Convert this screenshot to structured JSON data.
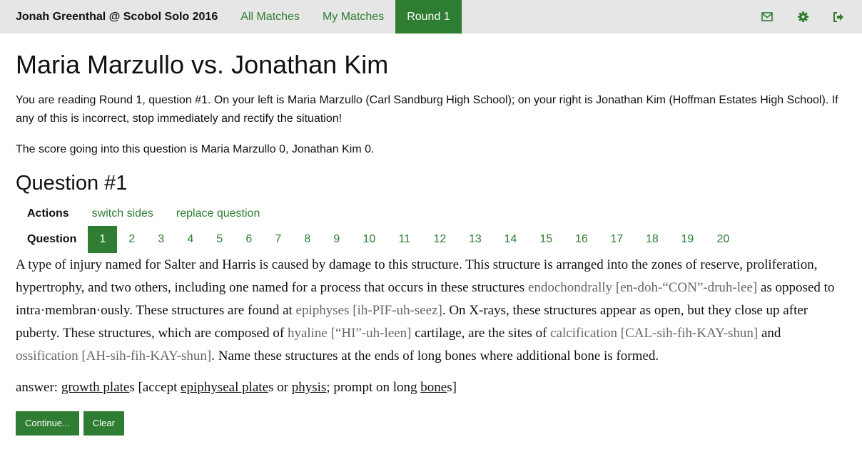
{
  "navbar": {
    "brand": "Jonah Greenthal @ Scobol Solo 2016",
    "links": [
      "All Matches",
      "My Matches",
      "Round 1"
    ],
    "icons": [
      "envelope-icon",
      "gear-icon",
      "sign-out-icon"
    ]
  },
  "colors": {
    "accent": "#2e7d32",
    "nav_bg": "#e6e6e6",
    "pronunciation": "#666666"
  },
  "match": {
    "title": "Maria Marzullo vs. Jonathan Kim",
    "intro": "You are reading Round 1, question #1. On your left is Maria Marzullo (Carl Sandburg High School); on your right is Jonathan Kim (Hoffman Estates High School). If any of this is incorrect, stop immediately and rectify the situation!",
    "score": "The score going into this question is Maria Marzullo 0, Jonathan Kim 0."
  },
  "question": {
    "heading": "Question #1",
    "actions_label": "Actions",
    "actions": [
      "switch sides",
      "replace question"
    ],
    "nav_label": "Question",
    "numbers": [
      "1",
      "2",
      "3",
      "4",
      "5",
      "6",
      "7",
      "8",
      "9",
      "10",
      "11",
      "12",
      "13",
      "14",
      "15",
      "16",
      "17",
      "18",
      "19",
      "20"
    ],
    "text": {
      "t1": "A type of injury named for Salter and Harris is caused by damage to this structure. This structure is arranged into the zones of reserve, proliferation, hypertrophy, and two others, including one named for a process that occurs in these structures ",
      "p1": "endochondrally [en-doh-“CON”-druh-lee]",
      "t2": " as opposed to intra·membran·ously. These structures are found at ",
      "p2": "epiphyses [ih-PIF-uh-seez]",
      "t3": ". On X-rays, these structures appear as open, but they close up after puberty. These structures, which are composed of ",
      "p3": "hyaline [“HI”-uh-leen]",
      "t4": " cartilage, are the sites of ",
      "p4": "calcification [CAL-sih-fih-KAY-shun]",
      "t5": " and ",
      "p5": "ossification [AH-sih-fih-KAY-shun]",
      "t6": ". Name these structures at the ends of long bones where additional bone is formed."
    },
    "answer": {
      "a1": "answer: ",
      "u1": "growth plate",
      "a2": "s [accept ",
      "u2": "epiphyseal plate",
      "a3": "s or ",
      "u3": "physis",
      "a4": "; prompt on long ",
      "u4": "bone",
      "a5": "s]"
    }
  },
  "buttons": {
    "continue": "Continue...",
    "clear": "Clear"
  }
}
